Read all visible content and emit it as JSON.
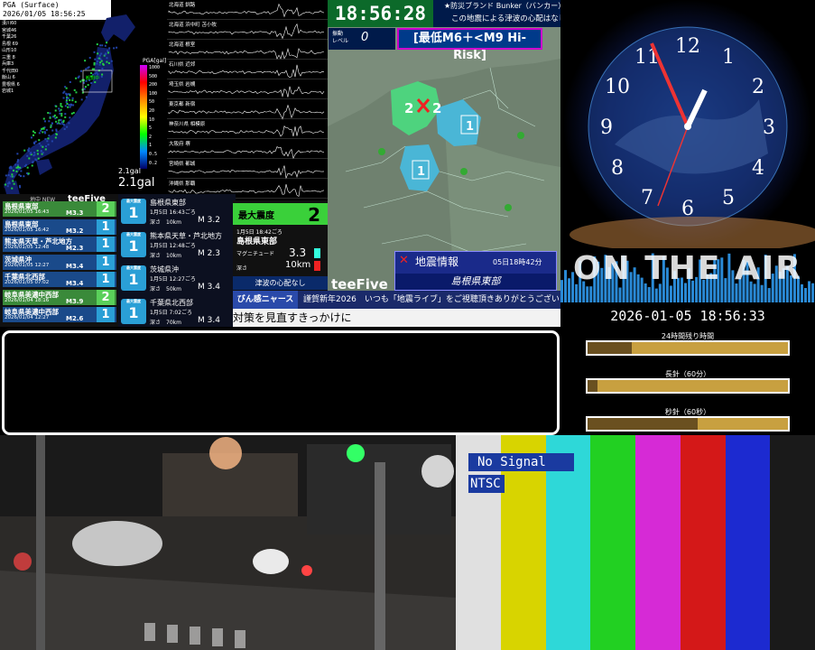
{
  "pga": {
    "title": "PGA (Surface)",
    "datetime": "2026/01/05 18:56:25",
    "unit": "PGA[gal]",
    "scale": [
      "1000",
      "500",
      "200",
      "100",
      "50",
      "20",
      "10",
      "5",
      "2",
      "1",
      "0.5",
      "0.2"
    ],
    "gal_caption": "2.1gal",
    "gal_value": "2.1gal",
    "prefectures": [
      "漢川60",
      "宮城46",
      "千葉26",
      "島根 69",
      "山形10",
      "三重 8",
      "兵庫3",
      "千代田0",
      "飯山 6",
      "豊根県 6",
      "岩城1"
    ],
    "marker": "観測中"
  },
  "wave": {
    "stations": [
      "北海道 釧路",
      "北海道 浜中町 苫小牧",
      "北海道 根室",
      "石川県 近郊",
      "埼玉県 岩槻",
      "東京都 新宿",
      "神奈川県 相模原",
      "大阪府 堺",
      "宮崎県 都城",
      "沖縄県 那覇"
    ]
  },
  "list": {
    "header": "地中 NEW",
    "logo": "teeFive",
    "rows": [
      {
        "name": "島根県東部",
        "date": "2026/01/05 16:43",
        "mag": "M3.3",
        "int": "2"
      },
      {
        "name": "島根県東部",
        "date": "2026/01/05 16:42",
        "mag": "M3.2",
        "int": "1"
      },
      {
        "name": "熊本県天草・芦北地方",
        "date": "2026/01/05 12:48",
        "mag": "M2.3",
        "int": "1"
      },
      {
        "name": "茨城県沖",
        "date": "2026/01/05 12:27",
        "mag": "M3.4",
        "int": "1"
      },
      {
        "name": "千葉県北西部",
        "date": "2026/01/05 07:02",
        "mag": "M3.4",
        "int": "1"
      },
      {
        "name": "岐阜県美濃中西部",
        "date": "2026/01/04 18:16",
        "mag": "M3.9",
        "int": "2"
      },
      {
        "name": "岐阜県美濃中西部",
        "date": "2026/01/04 12:27",
        "mag": "M2.6",
        "int": "1"
      }
    ]
  },
  "detail": {
    "rows": [
      {
        "label": "最大震度",
        "int": "1",
        "name": "島根県東部",
        "date": "1月5日 16:43ごろ",
        "depth": "深さ　10km",
        "mag": "M 3.2"
      },
      {
        "label": "最大震度",
        "int": "1",
        "name": "熊本県天草・芦北地方",
        "date": "1月5日 12:48ごろ",
        "depth": "深さ　10km",
        "mag": "M 2.3"
      },
      {
        "label": "最大震度",
        "int": "1",
        "name": "茨城県沖",
        "date": "1月5日 12:27ごろ",
        "depth": "深さ　50km",
        "mag": "M 3.4"
      },
      {
        "label": "最大震度",
        "int": "1",
        "name": "千葉県北西部",
        "date": "1月5日 7:02ごろ",
        "depth": "深さ　70km",
        "mag": "M 3.4"
      }
    ]
  },
  "maxpanel": {
    "label": "最大震度",
    "value": "2",
    "date": "1月5日 18:42ごろ",
    "name": "島根県東部",
    "mag_label": "マグニチュード",
    "mag": "3.3",
    "depth_label": "深さ",
    "depth": "10km",
    "note": "津波の心配なし"
  },
  "header": {
    "clock": "18:56:28",
    "bunker": "★防災ブランド Bunker（バンカー）",
    "tsunami": "この地震による津波の心配はなし",
    "level_label1": "振動",
    "level_label2": "レベル",
    "level": "0",
    "risk": "[最低M6＋<M9 Hi-Risk]"
  },
  "map": {
    "logo": "teeFive",
    "epicenter": "2",
    "markers": [
      "2",
      "1",
      "1"
    ],
    "info_title": "地震情報",
    "info_time": "05日18時42分",
    "info_area": "島根県東部"
  },
  "ticker": {
    "channel": "びん感ニャース",
    "message": "謹賀新年2026　いつも「地震ライブ」をご視聴頂きありがとうございます!",
    "line2": "対策を見直すきっかけに"
  },
  "space": {
    "numbers": [
      "12",
      "1",
      "2",
      "3",
      "4",
      "5",
      "6",
      "7",
      "8",
      "9",
      "10",
      "11"
    ]
  },
  "onair": {
    "banner": "ON THE AIR",
    "datetime": "2026-01-05 18:56:33",
    "bars": [
      {
        "label": "24時間残り時間",
        "fill": 0.22
      },
      {
        "label": "長針（60分）",
        "fill": 0.05
      },
      {
        "label": "秒針（60秒）",
        "fill": 0.55
      }
    ]
  },
  "bars": {
    "no_signal": "No Signal",
    "format": "NTSC",
    "colors": [
      "#e0e0e0",
      "#d8d400",
      "#2ed8d8",
      "#22d022",
      "#d62ad6",
      "#d41818",
      "#1c2ad0",
      "#1a1a1a"
    ]
  }
}
